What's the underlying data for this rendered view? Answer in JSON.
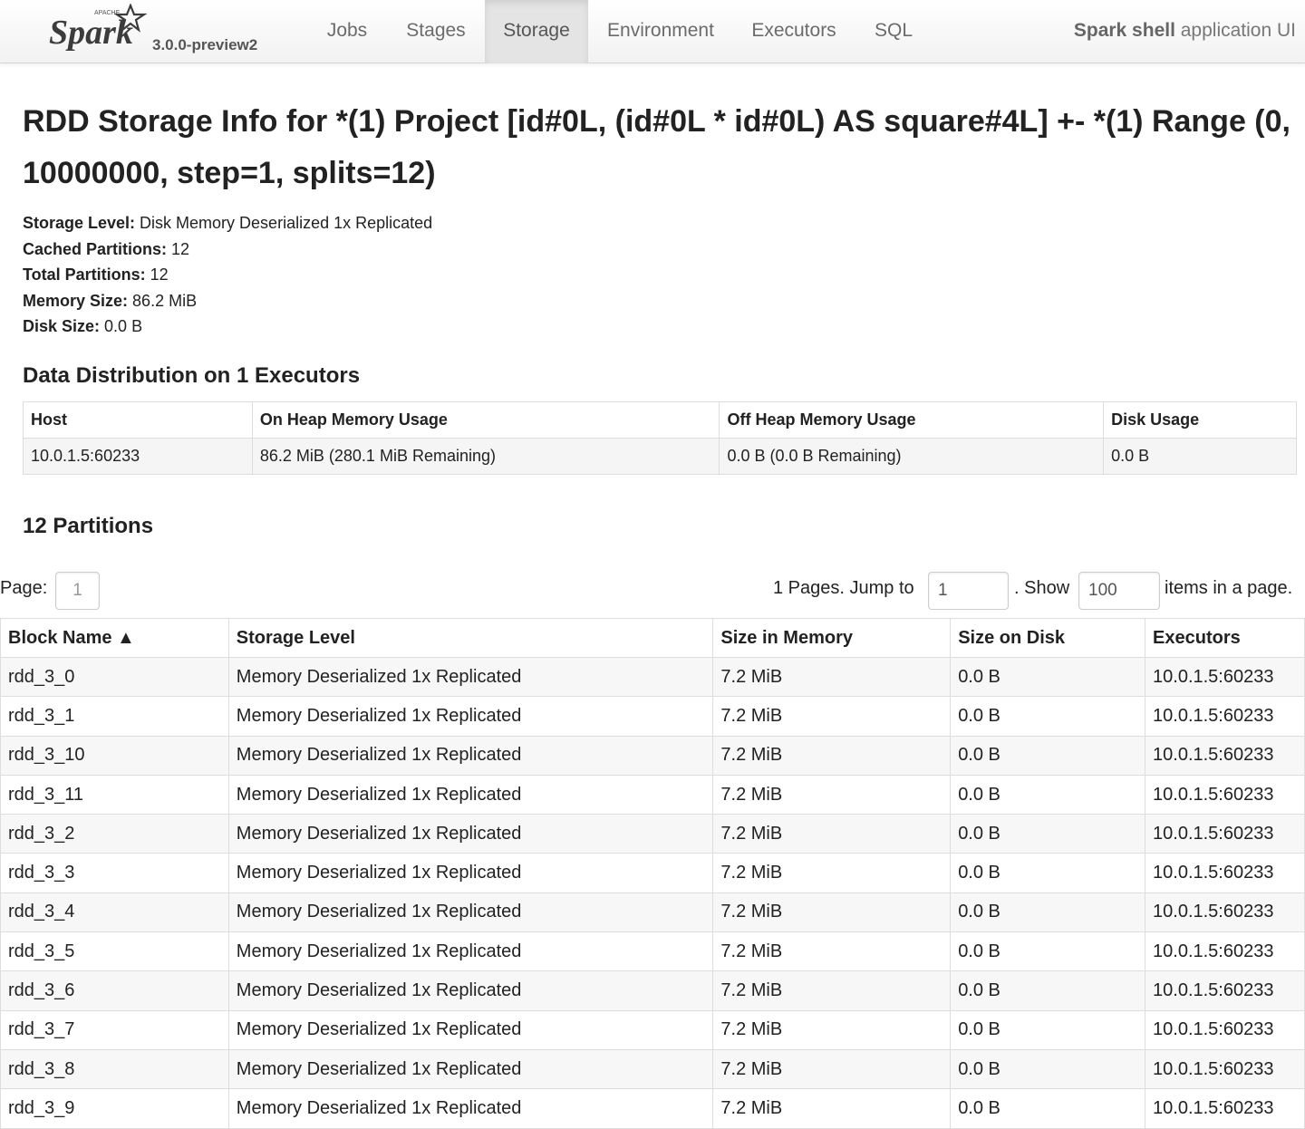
{
  "navbar": {
    "logo_text": "Spark",
    "logo_small": "APACHE",
    "version": "3.0.0-preview2",
    "tabs": [
      {
        "label": "Jobs"
      },
      {
        "label": "Stages"
      },
      {
        "label": "Storage"
      },
      {
        "label": "Environment"
      },
      {
        "label": "Executors"
      },
      {
        "label": "SQL"
      }
    ],
    "active_tab": "Storage",
    "app_name_bold": "Spark shell",
    "app_name_rest": " application UI"
  },
  "title": "RDD Storage Info for *(1) Project [id#0L, (id#0L * id#0L) AS square#4L] +- *(1) Range (0, 10000000, step=1, splits=12)",
  "summary": [
    {
      "label": "Storage Level:",
      "value": " Disk Memory Deserialized 1x Replicated"
    },
    {
      "label": "Cached Partitions:",
      "value": " 12"
    },
    {
      "label": "Total Partitions:",
      "value": " 12"
    },
    {
      "label": "Memory Size:",
      "value": " 86.2 MiB"
    },
    {
      "label": "Disk Size:",
      "value": " 0.0 B"
    }
  ],
  "distribution": {
    "heading": "Data Distribution on 1 Executors",
    "headers": [
      "Host",
      "On Heap Memory Usage",
      "Off Heap Memory Usage",
      "Disk Usage"
    ],
    "rows": [
      [
        "10.0.1.5:60233",
        "86.2 MiB (280.1 MiB Remaining)",
        "0.0 B (0.0 B Remaining)",
        "0.0 B"
      ]
    ]
  },
  "partitions": {
    "heading": "12 Partitions",
    "page_label": "Page:",
    "page_value": "1",
    "pages_text": "1 Pages. Jump to",
    "jump_value": "1",
    "show_text": ". Show",
    "show_value": "100",
    "items_text": "items in a page.",
    "headers": [
      "Block Name ▲",
      "Storage Level",
      "Size in Memory",
      "Size on Disk",
      "Executors"
    ],
    "rows": [
      [
        "rdd_3_0",
        "Memory Deserialized 1x Replicated",
        "7.2 MiB",
        "0.0 B",
        "10.0.1.5:60233"
      ],
      [
        "rdd_3_1",
        "Memory Deserialized 1x Replicated",
        "7.2 MiB",
        "0.0 B",
        "10.0.1.5:60233"
      ],
      [
        "rdd_3_10",
        "Memory Deserialized 1x Replicated",
        "7.2 MiB",
        "0.0 B",
        "10.0.1.5:60233"
      ],
      [
        "rdd_3_11",
        "Memory Deserialized 1x Replicated",
        "7.2 MiB",
        "0.0 B",
        "10.0.1.5:60233"
      ],
      [
        "rdd_3_2",
        "Memory Deserialized 1x Replicated",
        "7.2 MiB",
        "0.0 B",
        "10.0.1.5:60233"
      ],
      [
        "rdd_3_3",
        "Memory Deserialized 1x Replicated",
        "7.2 MiB",
        "0.0 B",
        "10.0.1.5:60233"
      ],
      [
        "rdd_3_4",
        "Memory Deserialized 1x Replicated",
        "7.2 MiB",
        "0.0 B",
        "10.0.1.5:60233"
      ],
      [
        "rdd_3_5",
        "Memory Deserialized 1x Replicated",
        "7.2 MiB",
        "0.0 B",
        "10.0.1.5:60233"
      ],
      [
        "rdd_3_6",
        "Memory Deserialized 1x Replicated",
        "7.2 MiB",
        "0.0 B",
        "10.0.1.5:60233"
      ],
      [
        "rdd_3_7",
        "Memory Deserialized 1x Replicated",
        "7.2 MiB",
        "0.0 B",
        "10.0.1.5:60233"
      ],
      [
        "rdd_3_8",
        "Memory Deserialized 1x Replicated",
        "7.2 MiB",
        "0.0 B",
        "10.0.1.5:60233"
      ],
      [
        "rdd_3_9",
        "Memory Deserialized 1x Replicated",
        "7.2 MiB",
        "0.0 B",
        "10.0.1.5:60233"
      ]
    ]
  }
}
